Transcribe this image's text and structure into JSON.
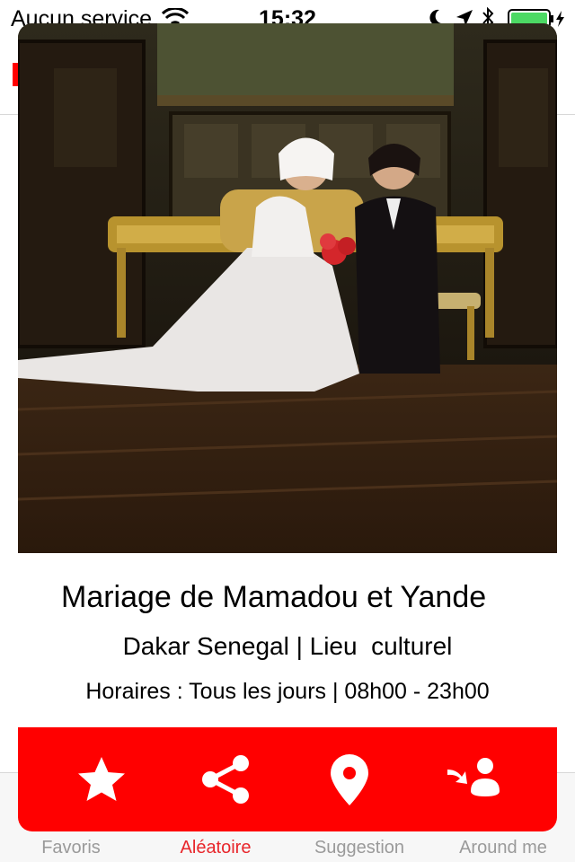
{
  "status_bar": {
    "carrier": "Aucun service",
    "time": "15:32"
  },
  "card": {
    "title": "Mariage de Mamadou et Yande",
    "subtitle": "Dakar Senegal | Lieu  culturel",
    "hours": "Horaires : Tous les jours | 08h00 - 23h00",
    "actions": [
      {
        "icon": "star-icon"
      },
      {
        "icon": "share-icon"
      },
      {
        "icon": "map-pin-icon"
      },
      {
        "icon": "user-forward-icon"
      }
    ]
  },
  "tab_bar": {
    "items": [
      {
        "label": "Favoris"
      },
      {
        "label": "Aléatoire",
        "active": true
      },
      {
        "label": "Suggestion"
      },
      {
        "label": "Around me"
      }
    ]
  },
  "colors": {
    "accent": "#ff0000",
    "tab_active": "#e8262b",
    "tab_inactive": "#9a9a9a"
  }
}
